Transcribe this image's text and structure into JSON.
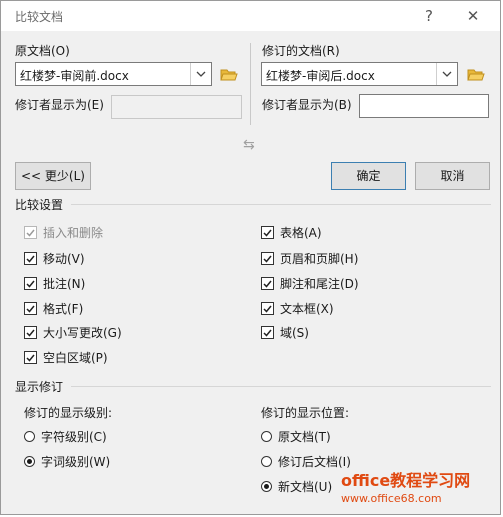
{
  "dialog": {
    "title": "比较文档"
  },
  "titlebar": {
    "help": "?",
    "close": "✕"
  },
  "original": {
    "label": "原文档(O)",
    "file": "红楼梦-审阅前.docx",
    "reviewer_label": "修订者显示为(E)",
    "reviewer_value": ""
  },
  "revised": {
    "label": "修订的文档(R)",
    "file": "红楼梦-审阅后.docx",
    "reviewer_label": "修订者显示为(B)",
    "reviewer_value": ""
  },
  "buttons": {
    "less": "<< 更少(L)",
    "ok": "确定",
    "cancel": "取消"
  },
  "compare_settings": {
    "title": "比较设置",
    "left": [
      {
        "label": "插入和删除",
        "checked": true,
        "disabled": true
      },
      {
        "label": "移动(V)",
        "checked": true,
        "disabled": false
      },
      {
        "label": "批注(N)",
        "checked": true,
        "disabled": false
      },
      {
        "label": "格式(F)",
        "checked": true,
        "disabled": false
      },
      {
        "label": "大小写更改(G)",
        "checked": true,
        "disabled": false
      },
      {
        "label": "空白区域(P)",
        "checked": true,
        "disabled": false
      }
    ],
    "right": [
      {
        "label": "表格(A)",
        "checked": true
      },
      {
        "label": "页眉和页脚(H)",
        "checked": true
      },
      {
        "label": "脚注和尾注(D)",
        "checked": true
      },
      {
        "label": "文本框(X)",
        "checked": true
      },
      {
        "label": "域(S)",
        "checked": true
      }
    ]
  },
  "show_changes": {
    "title": "显示修订",
    "level_label": "修订的显示级别:",
    "levels": [
      {
        "label": "字符级别(C)",
        "selected": false
      },
      {
        "label": "字词级别(W)",
        "selected": true
      }
    ],
    "position_label": "修订的显示位置:",
    "positions": [
      {
        "label": "原文档(T)",
        "selected": false
      },
      {
        "label": "修订后文档(I)",
        "selected": false
      },
      {
        "label": "新文档(U)",
        "selected": true
      }
    ]
  },
  "watermark": {
    "main": "office教程学习网",
    "url": "www.office68.com"
  },
  "colors": {
    "accent": "#3c7fb1",
    "folder": "#e8b83a",
    "watermark": "#e04a12"
  }
}
